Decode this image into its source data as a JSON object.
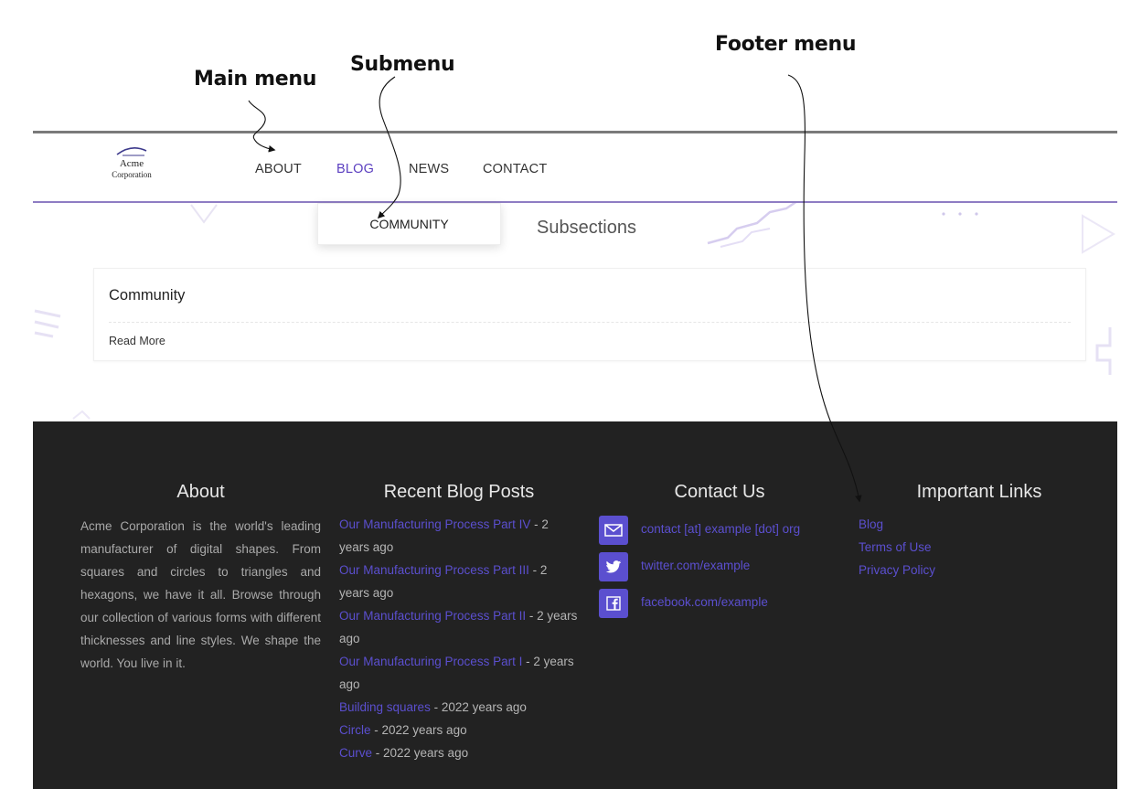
{
  "callouts": {
    "main_menu": "Main menu",
    "submenu": "Submenu",
    "footer_menu": "Footer menu"
  },
  "logo": {
    "line1": "Acme",
    "line2": "Corporation"
  },
  "nav": {
    "items": [
      {
        "label": "ABOUT"
      },
      {
        "label": "BLOG",
        "active": true
      },
      {
        "label": "NEWS"
      },
      {
        "label": "CONTACT"
      }
    ],
    "submenu": [
      "COMMUNITY"
    ]
  },
  "main": {
    "heading": "Subsections",
    "card": {
      "title": "Community",
      "link": "Read More"
    }
  },
  "footer": {
    "about": {
      "title": "About",
      "text": "Acme Corporation is the world's leading manufacturer of digital shapes. From squares and circles to triangles and hexagons, we have it all. Browse through our collection of various forms with different thicknesses and line styles. We shape the world. You live in it."
    },
    "recent_posts": {
      "title": "Recent Blog Posts",
      "posts": [
        {
          "title": "Our Manufacturing Process Part IV",
          "age": " - 2 years ago"
        },
        {
          "title": "Our Manufacturing Process Part III",
          "age": " - 2 years ago"
        },
        {
          "title": "Our Manufacturing Process Part II",
          "age": " - 2 years ago"
        },
        {
          "title": "Our Manufacturing Process Part I",
          "age": " - 2 years ago"
        },
        {
          "title": "Building squares",
          "age": " - 2022 years ago"
        },
        {
          "title": "Circle",
          "age": " - 2022 years ago"
        },
        {
          "title": "Curve",
          "age": " - 2022 years ago"
        }
      ]
    },
    "contact": {
      "title": "Contact Us",
      "items": [
        {
          "icon": "mail-icon",
          "text": "contact [at] example [dot] org"
        },
        {
          "icon": "twitter-icon",
          "text": "twitter.com/example"
        },
        {
          "icon": "facebook-icon",
          "text": "facebook.com/example"
        }
      ]
    },
    "important_links": {
      "title": "Important Links",
      "links": [
        "Blog",
        "Terms of Use",
        "Privacy Policy"
      ]
    }
  },
  "colors": {
    "accent": "#5b4fcf",
    "active_nav": "#5b3fc0",
    "footer_bg": "#222222",
    "nav_border": "#8e7cc3"
  }
}
